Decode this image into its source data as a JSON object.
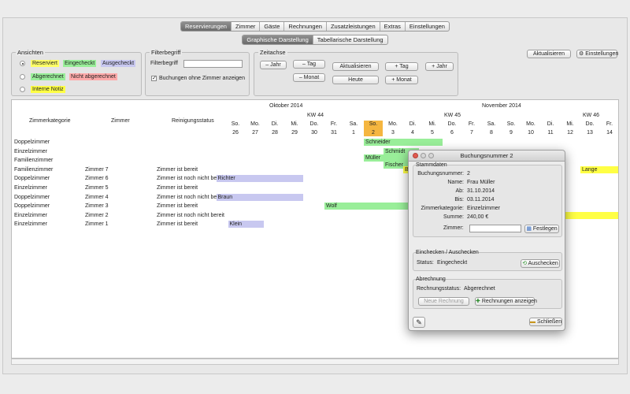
{
  "top_tabs": [
    "Reservierungen",
    "Zimmer",
    "Gäste",
    "Rechnungen",
    "Zusatzleistungen",
    "Extras",
    "Einstellungen"
  ],
  "sub_tabs": [
    "Graphische Darstellung",
    "Tabellarische Darstellung"
  ],
  "ansichten": {
    "title": "Ansichten",
    "rows": [
      {
        "chips": [
          {
            "label": "Reserviert",
            "color": "#ffff66"
          },
          {
            "label": "Eingecheckt",
            "color": "#99ee99"
          },
          {
            "label": "Ausgecheckt",
            "color": "#c8c8f0"
          }
        ]
      },
      {
        "chips": [
          {
            "label": "Abgerechnet",
            "color": "#99ee99"
          },
          {
            "label": "Nicht abgerechnet",
            "color": "#ffaaaa"
          }
        ]
      },
      {
        "chips": [
          {
            "label": "Interne Notiz",
            "color": "#ffff44"
          }
        ]
      }
    ]
  },
  "filter": {
    "title": "Filterbegriff",
    "label": "Filterbegriff",
    "value": "",
    "checkbox_label": "Buchungen ohne Zimmer anzeigen"
  },
  "zeitachse": {
    "title": "Zeitachse",
    "minus_jahr": "– Jahr",
    "minus_tag": "– Tag",
    "minus_monat": "– Monat",
    "aktualisieren": "Aktualisieren",
    "heute": "Heute",
    "plus_tag": "+ Tag",
    "plus_jahr": "+ Jahr",
    "plus_monat": "+ Monat"
  },
  "right_buttons": {
    "aktualisieren": "Aktualisieren",
    "einstellungen": "Einstellungen"
  },
  "grid": {
    "months": [
      {
        "label": "Oktober 2014"
      },
      {
        "label": "November 2014"
      }
    ],
    "kw": [
      "KW 44",
      "KW 45",
      "KW 46"
    ],
    "col_headers": {
      "kategorie": "Zimmerkategorie",
      "zimmer": "Zimmer",
      "status": "Reinigungsstatus"
    },
    "days": [
      {
        "wd": "So.",
        "d": "26"
      },
      {
        "wd": "Mo.",
        "d": "27"
      },
      {
        "wd": "Di.",
        "d": "28"
      },
      {
        "wd": "Mi.",
        "d": "29"
      },
      {
        "wd": "Do.",
        "d": "30"
      },
      {
        "wd": "Fr.",
        "d": "31"
      },
      {
        "wd": "Sa.",
        "d": "1"
      },
      {
        "wd": "So.",
        "d": "2",
        "today": true
      },
      {
        "wd": "Mo.",
        "d": "3"
      },
      {
        "wd": "Di.",
        "d": "4"
      },
      {
        "wd": "Mi.",
        "d": "5"
      },
      {
        "wd": "Do.",
        "d": "6"
      },
      {
        "wd": "Fr.",
        "d": "7"
      },
      {
        "wd": "Sa.",
        "d": "8"
      },
      {
        "wd": "So.",
        "d": "9"
      },
      {
        "wd": "Mo.",
        "d": "10"
      },
      {
        "wd": "Di.",
        "d": "11"
      },
      {
        "wd": "Mi.",
        "d": "12"
      },
      {
        "wd": "Do.",
        "d": "13"
      },
      {
        "wd": "Fr.",
        "d": "14"
      }
    ],
    "rows": [
      {
        "kategorie": "Doppelzimmer",
        "zimmer": "",
        "status": ""
      },
      {
        "kategorie": "Einzelzimmer",
        "zimmer": "",
        "status": ""
      },
      {
        "kategorie": "Familienzimmer",
        "zimmer": "",
        "status": ""
      },
      {
        "kategorie": "Familienzimmer",
        "zimmer": "Zimmer 7",
        "status": "Zimmer ist bereit"
      },
      {
        "kategorie": "Doppelzimmer",
        "zimmer": "Zimmer 6",
        "status": "Zimmer ist noch nicht bereit"
      },
      {
        "kategorie": "Einzelzimmer",
        "zimmer": "Zimmer 5",
        "status": "Zimmer ist bereit"
      },
      {
        "kategorie": "Doppelzimmer",
        "zimmer": "Zimmer 4",
        "status": "Zimmer ist noch nicht bereit"
      },
      {
        "kategorie": "Doppelzimmer",
        "zimmer": "Zimmer 3",
        "status": "Zimmer ist bereit"
      },
      {
        "kategorie": "Einzelzimmer",
        "zimmer": "Zimmer 2",
        "status": "Zimmer ist noch nicht bereit"
      },
      {
        "kategorie": "Einzelzimmer",
        "zimmer": "Zimmer 1",
        "status": "Zimmer ist bereit"
      }
    ],
    "bookings": [
      {
        "name": "Schneider",
        "row": 0,
        "start": 7.0,
        "end": 11.0,
        "color": "#99ee99"
      },
      {
        "name": "Schmidt",
        "row": 1,
        "start": 8.0,
        "end": 9.8,
        "color": "#99ee99"
      },
      {
        "name": "Müller",
        "row": 1.7,
        "start": 7.0,
        "end": 9.8,
        "color": "#99ee99"
      },
      {
        "name": "Fischer",
        "row": 2.5,
        "start": 8.0,
        "end": 9.8,
        "color": "#99ee99"
      },
      {
        "name": "Bauer",
        "row": 3,
        "start": 9.0,
        "end": 10.0,
        "color": "#ffff44"
      },
      {
        "name": "Lange",
        "row": 3,
        "start": 18.0,
        "end": 20.0,
        "color": "#ffff44"
      },
      {
        "name": "Richter",
        "row": 4,
        "start": -0.5,
        "end": 3.9,
        "color": "#c8c8f0"
      },
      {
        "name": "Braun",
        "row": 6,
        "start": -0.5,
        "end": 3.9,
        "color": "#c8c8f0"
      },
      {
        "name": "Wolf",
        "row": 7,
        "start": 5.0,
        "end": 10.0,
        "color": "#99ee99"
      },
      {
        "name": "rz",
        "row": 8,
        "start": 16.7,
        "end": 20.0,
        "color": "#ffff44"
      },
      {
        "name": "Klein",
        "row": 9,
        "start": 0.1,
        "end": 1.9,
        "color": "#c8c8f0"
      }
    ]
  },
  "dialog": {
    "title": "Buchungsnummer 2",
    "stamm": {
      "title": "Stammdaten",
      "fields": [
        {
          "label": "Buchungsnummer:",
          "value": "2"
        },
        {
          "label": "Name:",
          "value": "Frau Müller"
        },
        {
          "label": "Ab:",
          "value": "31.10.2014"
        },
        {
          "label": "Bis:",
          "value": "03.11.2014"
        },
        {
          "label": "Zimmerkategorie:",
          "value": "Einzelzimmer"
        },
        {
          "label": "Summe:",
          "value": "240,00 €"
        }
      ],
      "zimmer_label": "Zimmer:",
      "zimmer_value": "",
      "festlegen": "Festlegen"
    },
    "checkin": {
      "title": "Einchecken / Auschecken",
      "status_label": "Status:",
      "status_value": "Eingecheckt",
      "auschecken": "Auschecken"
    },
    "abrechnung": {
      "title": "Abrechnung",
      "status_label": "Rechnungsstatus:",
      "status_value": "Abgerechnet",
      "neue_rechnung": "Neue Rechnung",
      "rechnungen_anzeigen": "Rechnungen anzeigen"
    },
    "schliessen": "Schließen"
  }
}
